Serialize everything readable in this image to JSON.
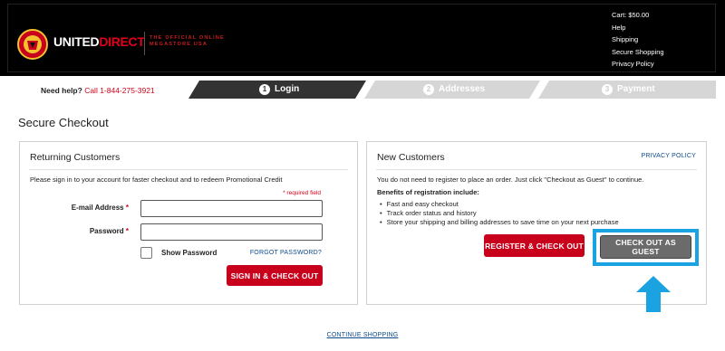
{
  "header": {
    "brand_part1": "UNITED",
    "brand_part2": "DIRECT",
    "tagline": "THE OFFICIAL ONLINE MEGASTORE USA",
    "top_links": [
      "Cart: $50.00",
      "Help",
      "Shipping",
      "Secure Shopping",
      "Privacy Policy"
    ]
  },
  "stepbar": {
    "help_label": "Need help?",
    "help_phone": "Call 1-844-275-3921",
    "steps": [
      {
        "number": "1",
        "label": "Login",
        "active": true
      },
      {
        "number": "2",
        "label": "Addresses",
        "active": false
      },
      {
        "number": "3",
        "label": "Payment",
        "active": false
      }
    ]
  },
  "page_title": "Secure Checkout",
  "returning": {
    "title": "Returning Customers",
    "intro": "Please sign in to your account for faster checkout and to redeem Promotional Credit",
    "required_note": "* required field",
    "email_label": "E-mail Address",
    "email_value": "",
    "password_label": "Password",
    "password_value": "",
    "required_star": "*",
    "show_password_label": "Show Password",
    "forgot_link": "FORGOT PASSWORD?",
    "signin_button": "SIGN IN & CHECK OUT"
  },
  "new_customers": {
    "title": "New Customers",
    "privacy_link": "PRIVACY POLICY",
    "intro": "You do not need to register to place an order. Just click \"Checkout as Guest\" to continue.",
    "benefits_heading": "Benefits of registration include:",
    "benefits": [
      "Fast and easy checkout",
      "Track order status and history",
      "Store your shipping and billing addresses to save time on your next purchase"
    ],
    "register_button": "REGISTER & CHECK OUT",
    "guest_button": "CHECK OUT AS GUEST"
  },
  "continue_link": "CONTINUE SHOPPING",
  "colors": {
    "accent_red": "#c8001b",
    "highlight_blue": "#1aa3e0",
    "link_blue": "#0b4a8b",
    "step_active": "#333333",
    "step_inactive": "#d6d6d6"
  }
}
